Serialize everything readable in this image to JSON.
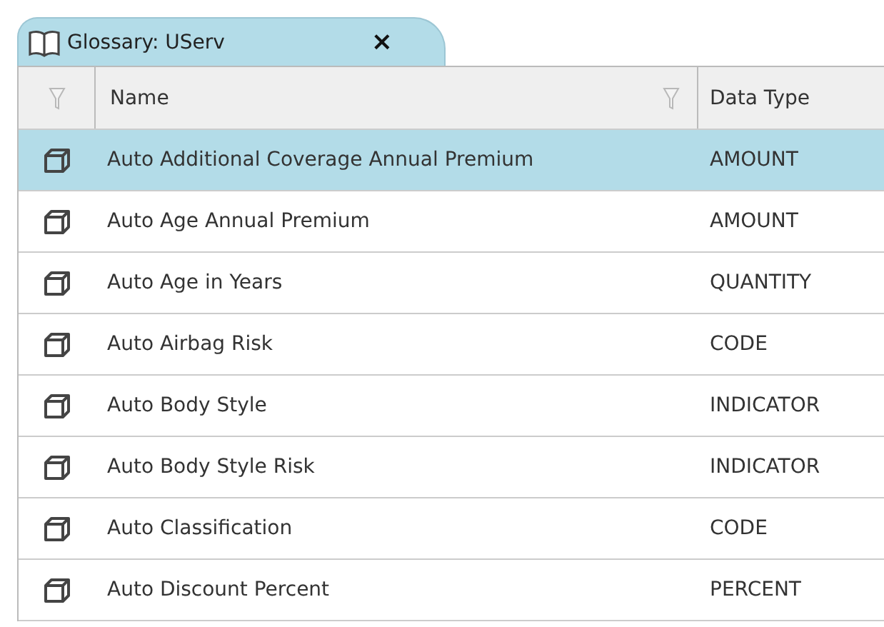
{
  "tab": {
    "title": "Glossary: UServ",
    "close": "×"
  },
  "table": {
    "columns": [
      {
        "label": "Name",
        "filter": true
      },
      {
        "label": "Data Type",
        "filter": false
      }
    ],
    "rows": [
      {
        "name": "Auto Additional Coverage Annual Premium",
        "data_type": "AMOUNT",
        "selected": true
      },
      {
        "name": "Auto Age Annual Premium",
        "data_type": "AMOUNT",
        "selected": false
      },
      {
        "name": "Auto Age in Years",
        "data_type": "QUANTITY",
        "selected": false
      },
      {
        "name": "Auto Airbag Risk",
        "data_type": "CODE",
        "selected": false
      },
      {
        "name": "Auto Body Style",
        "data_type": "INDICATOR",
        "selected": false
      },
      {
        "name": "Auto Body Style Risk",
        "data_type": "INDICATOR",
        "selected": false
      },
      {
        "name": "Auto Classification",
        "data_type": "CODE",
        "selected": false
      },
      {
        "name": "Auto Discount Percent",
        "data_type": "PERCENT",
        "selected": false
      }
    ]
  }
}
